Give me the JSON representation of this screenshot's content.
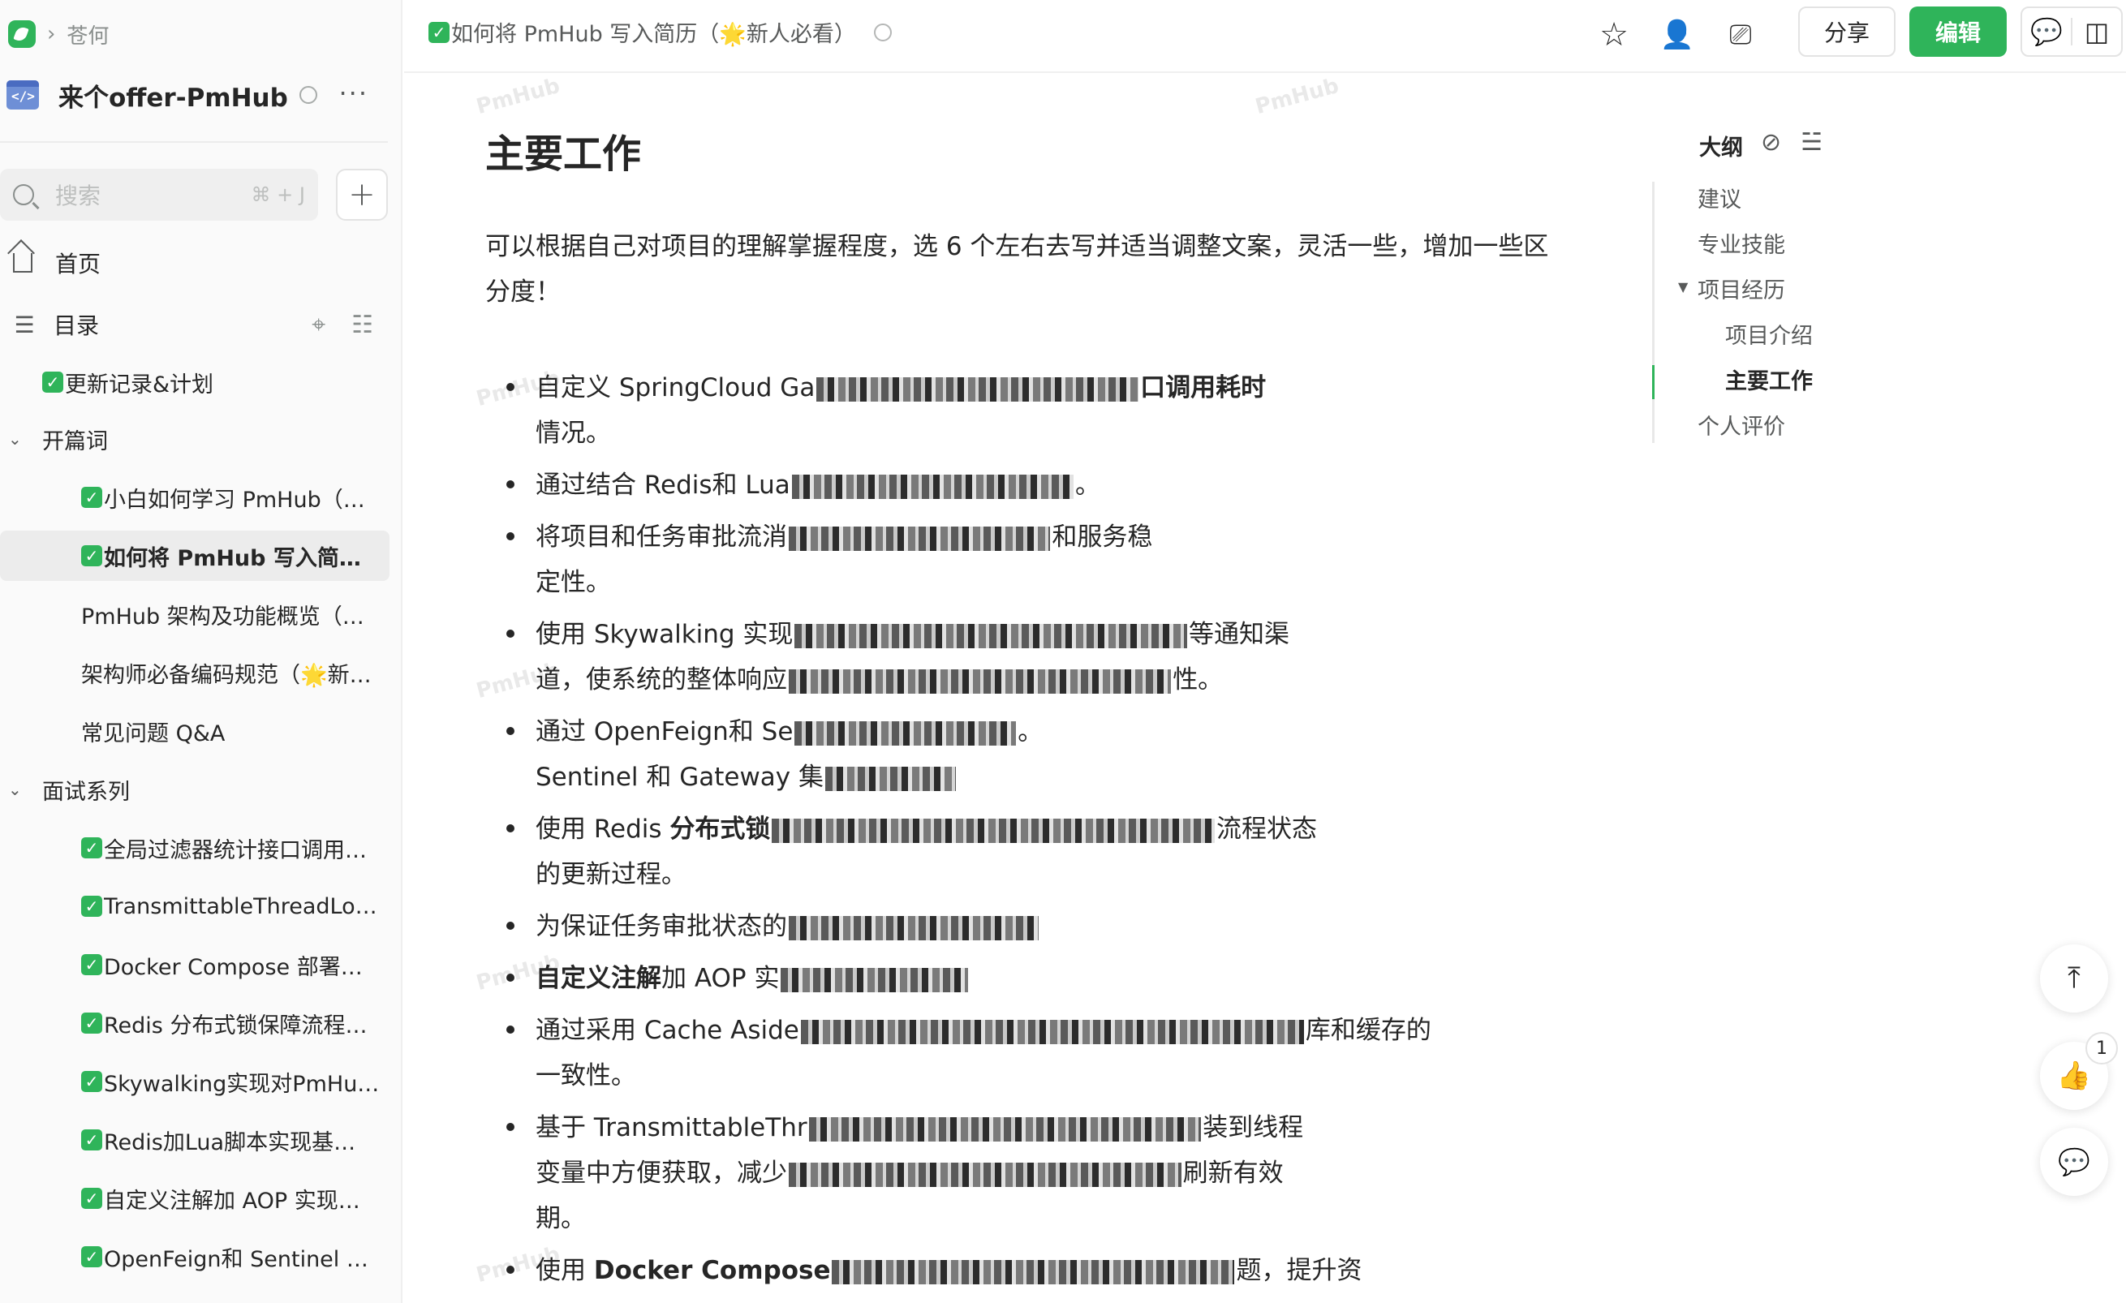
{
  "breadcrumb": {
    "separator": "›",
    "space_name": "苍何"
  },
  "book": {
    "title": "来个offer-PmHub",
    "more_label": "···"
  },
  "search": {
    "placeholder": "搜索",
    "shortcut": "⌘ + J",
    "add_label": "+"
  },
  "nav": {
    "home_label": "首页",
    "toc_label": "目录"
  },
  "tree": {
    "items": [
      {
        "label": "更新记录&计划",
        "checked": true,
        "indent": 1,
        "active": false
      },
      {
        "label": "开篇词",
        "group": true,
        "indent": 0
      },
      {
        "label": "小白如何学习 PmHub（…",
        "checked": true,
        "indent": 2,
        "active": false
      },
      {
        "label": "如何将 PmHub 写入简…",
        "checked": true,
        "indent": 2,
        "active": true
      },
      {
        "label": "PmHub 架构及功能概览（…",
        "checked": false,
        "indent": 2,
        "active": false
      },
      {
        "label": "架构师必备编码规范（🌟新…",
        "checked": false,
        "indent": 2,
        "active": false
      },
      {
        "label": "常见问题 Q&A",
        "checked": false,
        "indent": 2,
        "active": false
      },
      {
        "label": "面试系列",
        "group": true,
        "indent": 0
      },
      {
        "label": "全局过滤器统计接口调用…",
        "checked": true,
        "indent": 2,
        "active": false
      },
      {
        "label": "TransmittableThreadLo…",
        "checked": true,
        "indent": 2,
        "active": false
      },
      {
        "label": "Docker Compose 部署…",
        "checked": true,
        "indent": 2,
        "active": false
      },
      {
        "label": "Redis 分布式锁保障流程…",
        "checked": true,
        "indent": 2,
        "active": false
      },
      {
        "label": "Skywalking实现对PmHu…",
        "checked": true,
        "indent": 2,
        "active": false
      },
      {
        "label": "Redis加Lua脚本实现基…",
        "checked": true,
        "indent": 2,
        "active": false
      },
      {
        "label": "自定义注解加 AOP 实现…",
        "checked": true,
        "indent": 2,
        "active": false
      },
      {
        "label": "OpenFeign和 Sentinel …",
        "checked": true,
        "indent": 2,
        "active": false
      }
    ]
  },
  "topbar": {
    "doc_title": "如何将 PmHub 写入简历（🌟新人必看）",
    "share_label": "分享",
    "edit_label": "编辑",
    "icons": [
      "star-icon",
      "add-collaborator-icon",
      "present-icon",
      "comment-icon",
      "sidebar-toggle-icon"
    ]
  },
  "content": {
    "heading": "主要工作",
    "intro": "可以根据自己对项目的理解掌握程度，选 6 个左右去写并适当调整文案，灵活一些，增加一些区分度！",
    "bullets": [
      {
        "pre": "自定义 SpringCloud Ga",
        "post": "口调用耗时",
        "post_bold": true,
        "line2": "情况。"
      },
      {
        "pre": "通过结合 Redis和 Lua",
        "post": "。"
      },
      {
        "pre": "将项目和任务审批流消",
        "post": "和服务稳",
        "line2": "定性。"
      },
      {
        "pre": "使用 Skywalking 实现",
        "post": "等通知渠",
        "line2pre": "道，使系统的整体响应",
        "line2post": "性。"
      },
      {
        "pre": "通过 OpenFeign和 Se",
        "post": "。",
        "line2pre": "Sentinel 和 Gateway 集",
        "line2post": ""
      },
      {
        "pre": "使用 Redis ",
        "pre_bold": "分布式锁",
        "post": "流程状态",
        "line2": "的更新过程。"
      },
      {
        "pre": "为保证任务审批状态的",
        "post": ""
      },
      {
        "pre_bold": "自定义注解",
        "pre": "加 AOP 实",
        "post": ""
      },
      {
        "pre": "通过采用 Cache Aside",
        "post": "库和缓存的",
        "line2": "一致性。"
      },
      {
        "pre": "基于 TransmittableThr",
        "post": "装到线程",
        "line2pre": "变量中方便获取，减少",
        "line2post": "刷新有效",
        "line3": "期。"
      },
      {
        "pre": "使用 ",
        "pre_bold": "Docker Compose",
        "post": "题，提升资"
      }
    ]
  },
  "outline": {
    "title": "大纲",
    "items": [
      {
        "label": "建议",
        "level": 1
      },
      {
        "label": "专业技能",
        "level": 1
      },
      {
        "label": "项目经历",
        "level": 1,
        "expanded": true
      },
      {
        "label": "项目介绍",
        "level": 2
      },
      {
        "label": "主要工作",
        "level": 2,
        "active": true
      },
      {
        "label": "个人评价",
        "level": 1
      }
    ]
  },
  "floating": {
    "like_count": "1"
  },
  "watermark": "PmHub"
}
